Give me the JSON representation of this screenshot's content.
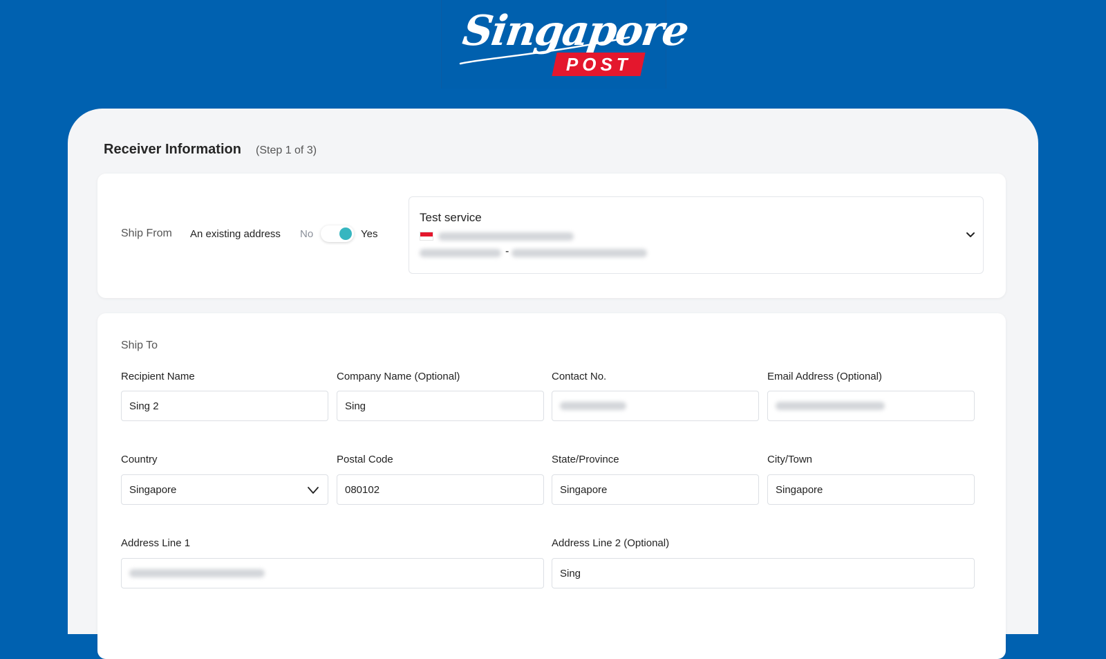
{
  "brand": {
    "script_text": "Singapore",
    "badge_text": "POST",
    "colors": {
      "brand_blue": "#0061b0",
      "brand_red": "#e4172d",
      "accent_teal": "#37b6c0"
    }
  },
  "page": {
    "title": "Receiver Information",
    "step": "(Step 1 of 3)"
  },
  "ship_from": {
    "label": "Ship From",
    "existing_label": "An existing address",
    "toggle": {
      "off_label": "No",
      "on_label": "Yes",
      "value": true
    },
    "selected_address": {
      "service_name": "Test service",
      "flag_icon": "singapore-flag-icon",
      "separator": "-"
    }
  },
  "ship_to": {
    "label": "Ship To",
    "fields": {
      "recipient_name": {
        "label": "Recipient Name",
        "value": "Sing 2"
      },
      "company_name": {
        "label": "Company Name (Optional)",
        "value": "Sing"
      },
      "contact_no": {
        "label": "Contact No."
      },
      "email": {
        "label": "Email Address (Optional)"
      },
      "country": {
        "label": "Country",
        "value": "Singapore"
      },
      "postal_code": {
        "label": "Postal Code",
        "value": "080102"
      },
      "state": {
        "label": "State/Province",
        "value": "Singapore"
      },
      "city": {
        "label": "City/Town",
        "value": "Singapore"
      },
      "address_line_1": {
        "label": "Address Line 1"
      },
      "address_line_2": {
        "label": "Address Line 2 (Optional)",
        "value": "Sing"
      }
    }
  },
  "icons": [
    "chevron-down-icon",
    "singapore-flag-icon"
  ]
}
